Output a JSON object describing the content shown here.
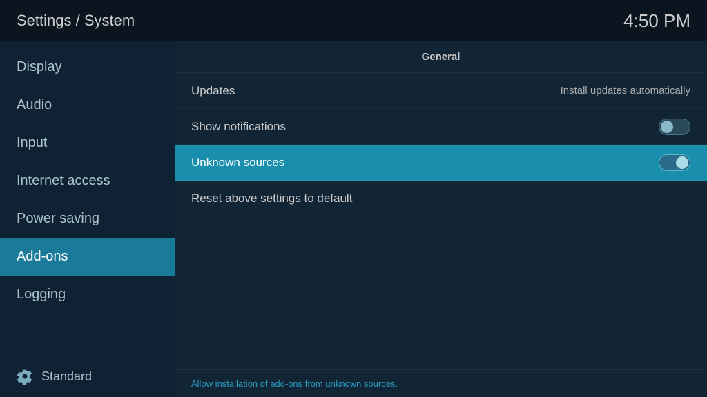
{
  "header": {
    "title": "Settings / System",
    "time": "4:50 PM"
  },
  "sidebar": {
    "items": [
      {
        "id": "display",
        "label": "Display",
        "active": false
      },
      {
        "id": "audio",
        "label": "Audio",
        "active": false
      },
      {
        "id": "input",
        "label": "Input",
        "active": false
      },
      {
        "id": "internet-access",
        "label": "Internet access",
        "active": false
      },
      {
        "id": "power-saving",
        "label": "Power saving",
        "active": false
      },
      {
        "id": "add-ons",
        "label": "Add-ons",
        "active": true
      },
      {
        "id": "logging",
        "label": "Logging",
        "active": false
      }
    ],
    "footer_label": "Standard"
  },
  "main": {
    "section_header": "General",
    "settings": [
      {
        "id": "updates",
        "label": "Updates",
        "value_text": "Install updates automatically",
        "toggle": null,
        "highlighted": false
      },
      {
        "id": "show-notifications",
        "label": "Show notifications",
        "value_text": null,
        "toggle": "off",
        "highlighted": false
      },
      {
        "id": "unknown-sources",
        "label": "Unknown sources",
        "value_text": null,
        "toggle": "on",
        "highlighted": true
      },
      {
        "id": "reset",
        "label": "Reset above settings to default",
        "value_text": null,
        "toggle": null,
        "highlighted": false
      }
    ],
    "footer_hint": "Allow installation of add-ons from unknown sources."
  }
}
